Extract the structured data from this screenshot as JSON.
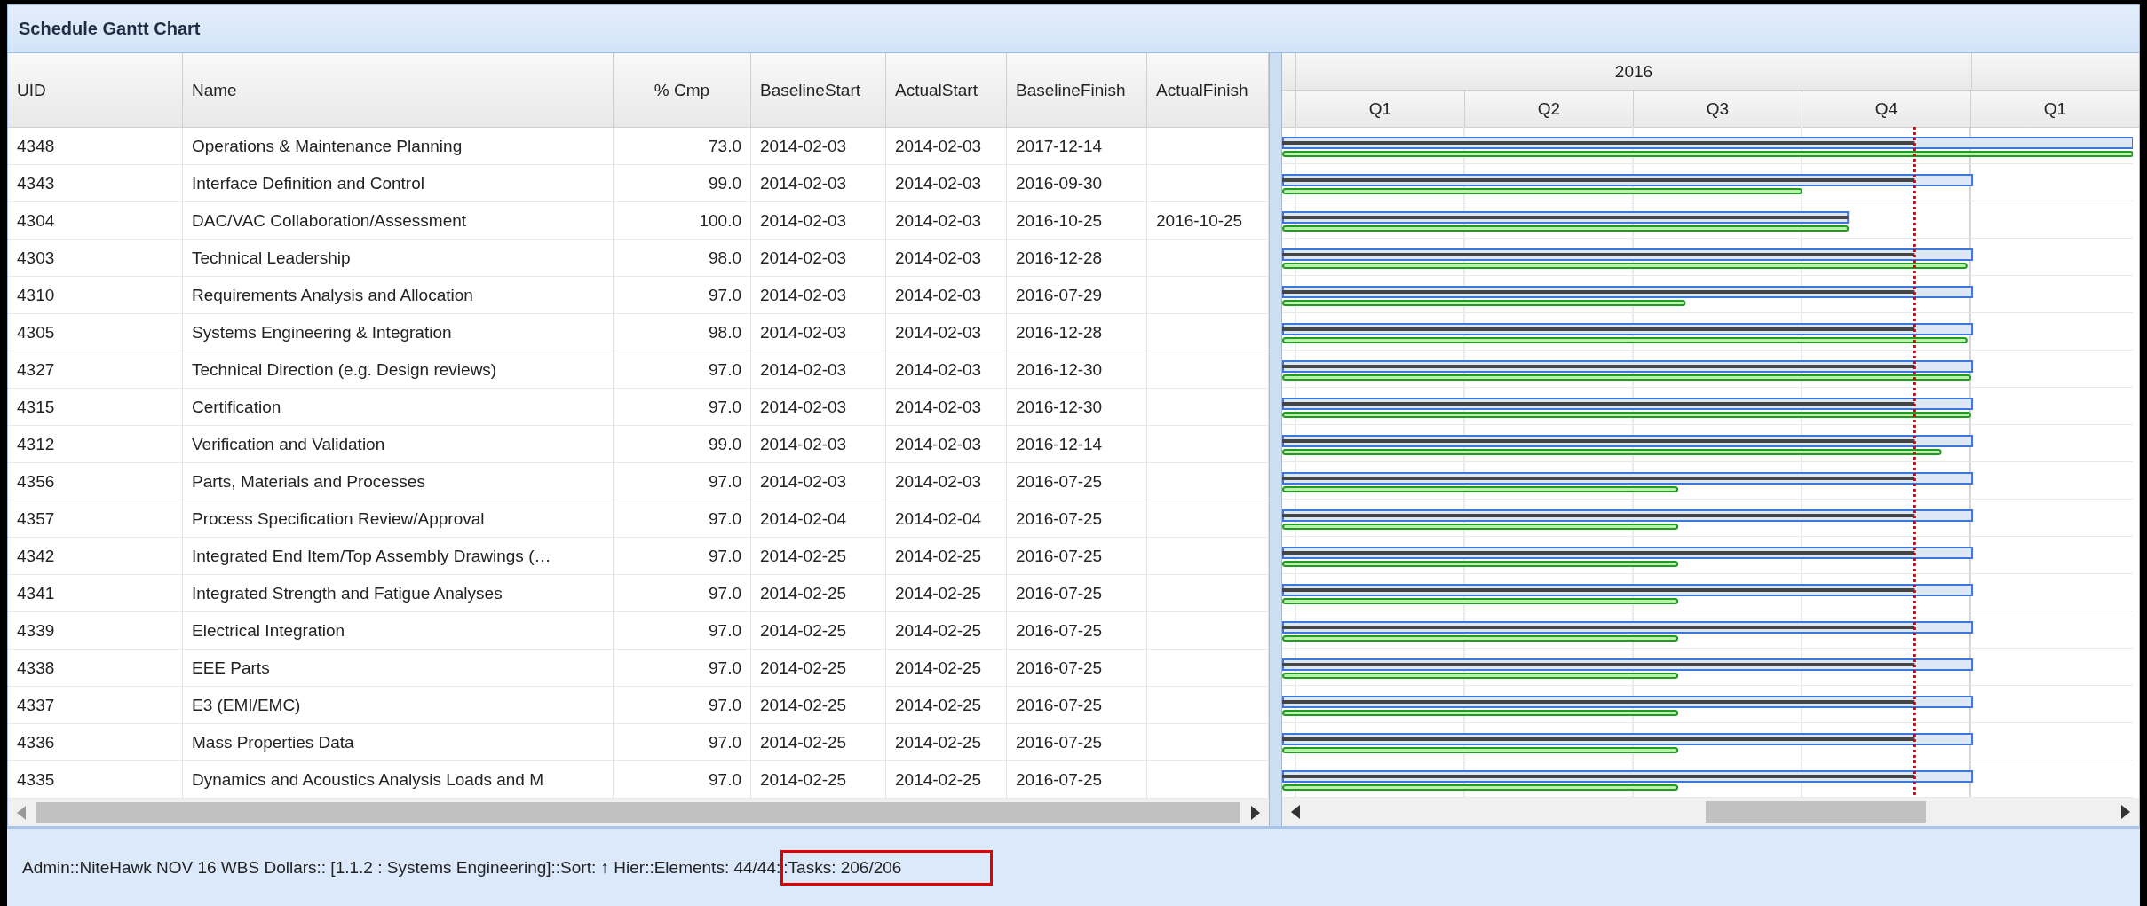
{
  "panel": {
    "title": "Schedule Gantt Chart"
  },
  "table": {
    "columns": [
      {
        "label": "UID"
      },
      {
        "label": "Name"
      },
      {
        "label": "% Cmp"
      },
      {
        "label": "BaselineStart"
      },
      {
        "label": "ActualStart"
      },
      {
        "label": "BaselineFinish"
      },
      {
        "label": "ActualFinish"
      }
    ],
    "rows": [
      {
        "uid": "4348",
        "name": "Operations & Maintenance Planning",
        "pct": "73.0",
        "baseline_start": "2014-02-03",
        "actual_start": "2014-02-03",
        "baseline_finish": "2017-12-14"
      },
      {
        "uid": "4343",
        "name": "Interface Definition and Control",
        "pct": "99.0",
        "baseline_start": "2014-02-03",
        "actual_start": "2014-02-03",
        "baseline_finish": "2016-09-30"
      },
      {
        "uid": "4304",
        "name": "DAC/VAC Collaboration/Assessment",
        "pct": "100.0",
        "baseline_start": "2014-02-03",
        "actual_start": "2014-02-03",
        "baseline_finish": "2016-10-25",
        "actual_finish": "2016-10-25"
      },
      {
        "uid": "4303",
        "name": "Technical Leadership",
        "pct": "98.0",
        "baseline_start": "2014-02-03",
        "actual_start": "2014-02-03",
        "baseline_finish": "2016-12-28"
      },
      {
        "uid": "4310",
        "name": "Requirements Analysis and Allocation",
        "pct": "97.0",
        "baseline_start": "2014-02-03",
        "actual_start": "2014-02-03",
        "baseline_finish": "2016-07-29"
      },
      {
        "uid": "4305",
        "name": "Systems Engineering & Integration",
        "pct": "98.0",
        "baseline_start": "2014-02-03",
        "actual_start": "2014-02-03",
        "baseline_finish": "2016-12-28"
      },
      {
        "uid": "4327",
        "name": "Technical Direction (e.g. Design reviews)",
        "pct": "97.0",
        "baseline_start": "2014-02-03",
        "actual_start": "2014-02-03",
        "baseline_finish": "2016-12-30"
      },
      {
        "uid": "4315",
        "name": "Certification",
        "pct": "97.0",
        "baseline_start": "2014-02-03",
        "actual_start": "2014-02-03",
        "baseline_finish": "2016-12-30"
      },
      {
        "uid": "4312",
        "name": "Verification and Validation",
        "pct": "99.0",
        "baseline_start": "2014-02-03",
        "actual_start": "2014-02-03",
        "baseline_finish": "2016-12-14"
      },
      {
        "uid": "4356",
        "name": "Parts, Materials and Processes",
        "pct": "97.0",
        "baseline_start": "2014-02-03",
        "actual_start": "2014-02-03",
        "baseline_finish": "2016-07-25"
      },
      {
        "uid": "4357",
        "name": "Process Specification Review/Approval",
        "pct": "97.0",
        "baseline_start": "2014-02-04",
        "actual_start": "2014-02-04",
        "baseline_finish": "2016-07-25"
      },
      {
        "uid": "4342",
        "name": "Integrated End Item/Top Assembly Drawings (…",
        "pct": "97.0",
        "baseline_start": "2014-02-25",
        "actual_start": "2014-02-25",
        "baseline_finish": "2016-07-25"
      },
      {
        "uid": "4341",
        "name": "Integrated Strength and Fatigue Analyses",
        "pct": "97.0",
        "baseline_start": "2014-02-25",
        "actual_start": "2014-02-25",
        "baseline_finish": "2016-07-25"
      },
      {
        "uid": "4339",
        "name": "Electrical Integration",
        "pct": "97.0",
        "baseline_start": "2014-02-25",
        "actual_start": "2014-02-25",
        "baseline_finish": "2016-07-25"
      },
      {
        "uid": "4338",
        "name": "EEE Parts",
        "pct": "97.0",
        "baseline_start": "2014-02-25",
        "actual_start": "2014-02-25",
        "baseline_finish": "2016-07-25"
      },
      {
        "uid": "4337",
        "name": "E3 (EMI/EMC)",
        "pct": "97.0",
        "baseline_start": "2014-02-25",
        "actual_start": "2014-02-25",
        "baseline_finish": "2016-07-25"
      },
      {
        "uid": "4336",
        "name": "Mass Properties Data",
        "pct": "97.0",
        "baseline_start": "2014-02-25",
        "actual_start": "2014-02-25",
        "baseline_finish": "2016-07-25"
      },
      {
        "uid": "4335",
        "name": "Dynamics and Acoustics Analysis Loads and M",
        "pct": "97.0",
        "baseline_start": "2014-02-25",
        "actual_start": "2014-02-25",
        "baseline_finish": "2016-07-25"
      }
    ]
  },
  "gantt": {
    "year": "2016",
    "quarters": [
      "Q1",
      "Q2",
      "Q3",
      "Q4",
      "Q1"
    ]
  },
  "status_bar": [
    {
      "text": "Admin::NiteHawk NOV 16 WBS Dollars:: [1.1.2 : Systems Engineering]::Sort: ↑ Hier::Elements: 44/44:",
      "highlighted": false
    },
    {
      "text": ":Tasks: 206/206",
      "highlighted": true
    }
  ]
}
